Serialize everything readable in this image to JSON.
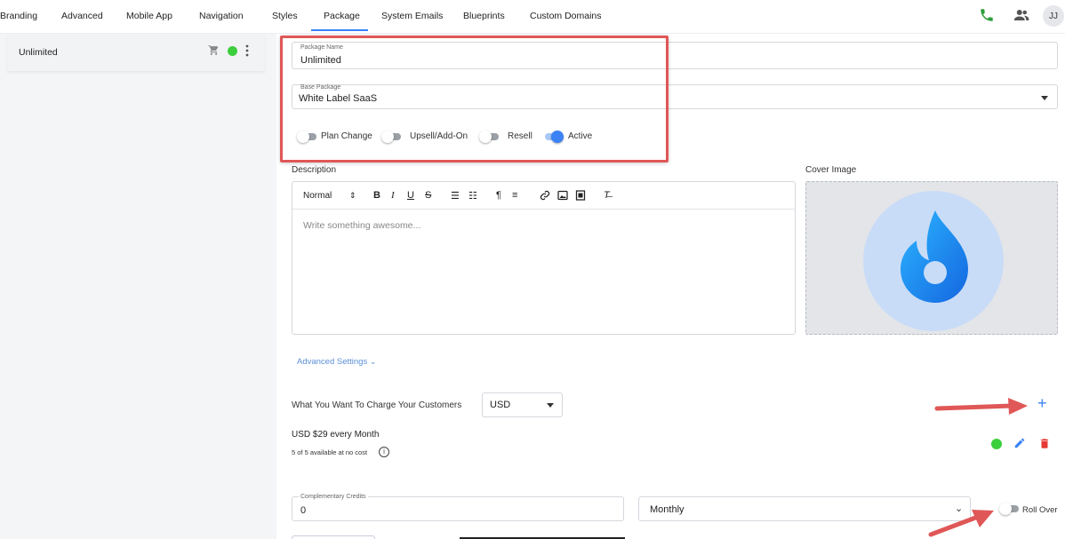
{
  "nav": {
    "tabs": [
      "Branding",
      "Advanced",
      "Mobile App",
      "Navigation",
      "Styles",
      "Package",
      "System Emails",
      "Blueprints",
      "Custom Domains"
    ],
    "active_tab": "Package",
    "avatar_initials": "JJ",
    "icons": [
      "phone-icon",
      "users-icon"
    ]
  },
  "sidebar": {
    "package_name": "Unlimited",
    "status_color": "#3ccf3c"
  },
  "form": {
    "package_name_label": "Package Name",
    "package_name_value": "Unlimited",
    "base_package_label": "Base Package",
    "base_package_value": "White Label SaaS",
    "toggles": {
      "plan_change": {
        "label": "Plan Change",
        "on": false
      },
      "upsell": {
        "label": "Upsell/Add-On",
        "on": false
      },
      "resell": {
        "label": "Resell",
        "on": false
      },
      "active": {
        "label": "Active",
        "on": true
      }
    },
    "description_label": "Description",
    "editor_format": "Normal",
    "editor_placeholder": "Write something awesome...",
    "cover_image_label": "Cover Image",
    "advanced_settings": "Advanced Settings",
    "charge_label": "What You Want To Charge Your Customers",
    "currency": "USD",
    "price_summary": "USD $29 every Month",
    "availability": "5 of 5 available at no cost",
    "credits_label": "Complementary Credits",
    "credits_value": "0",
    "billing_period": "Monthly",
    "roll_over_label": "Roll Over",
    "roll_over_on": false
  },
  "colors": {
    "accent": "#3b82f6",
    "annotation_red": "#e05757",
    "delete_red": "#e53935",
    "success_green": "#3ccf3c"
  }
}
